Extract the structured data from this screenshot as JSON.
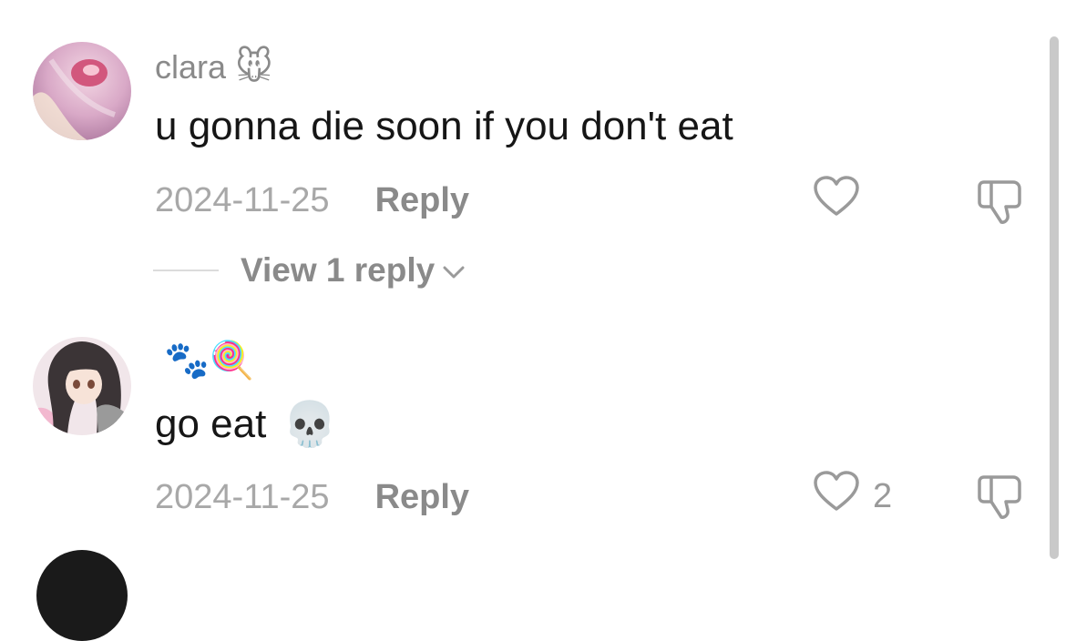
{
  "comments": [
    {
      "username": "clara",
      "username_emoji": "🐭",
      "avatar_icon": "avatar-pink-photo",
      "text": "u gonna die soon if you don't eat",
      "text_emoji": "",
      "date": "2024-11-25",
      "reply_label": "Reply",
      "like_count": "",
      "view_replies_label": "View 1 reply"
    },
    {
      "username": "",
      "username_emoji": "🐾🍭",
      "avatar_icon": "avatar-anime-girl",
      "text": "go eat",
      "text_emoji": "💀",
      "date": "2024-11-25",
      "reply_label": "Reply",
      "like_count": "2"
    }
  ],
  "colors": {
    "secondary_text": "#8a8a8a",
    "date_text": "#a8a8a8",
    "primary_text": "#161616",
    "icon": "#9a9a9a"
  }
}
